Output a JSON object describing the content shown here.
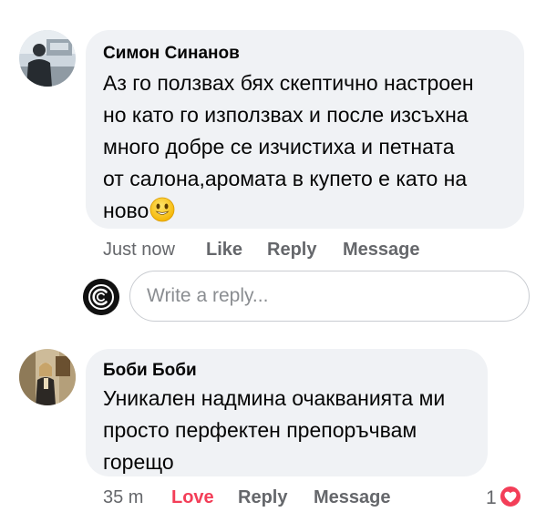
{
  "comments": [
    {
      "author": "Симон Синанов",
      "lines": [
        "Аз го ползвах бях скептично настроен",
        "но като го използвах и после изсъхна",
        "много добре се изчистиха и петната",
        "от салона,аромата в купето е като на",
        "ново"
      ],
      "emoji": "smiling-face-emoji",
      "timestamp": "Just now",
      "actions": {
        "like": "Like",
        "reply": "Reply",
        "message": "Message"
      }
    },
    {
      "author": "Боби Боби",
      "lines": [
        "Уникален надмина очакванията ми",
        "просто перфектен препоръчвам",
        "горещо"
      ],
      "timestamp": "35 m",
      "actions": {
        "like": "Love",
        "reply": "Reply",
        "message": "Message"
      },
      "reaction_count": "1",
      "reaction_icon": "heart-icon",
      "reaction_color": "#f33e58"
    }
  ],
  "reply_box": {
    "placeholder": "Write a reply..."
  },
  "colors": {
    "bubble": "#f0f2f5",
    "secondary_text": "#65676b",
    "love": "#f33e58"
  }
}
